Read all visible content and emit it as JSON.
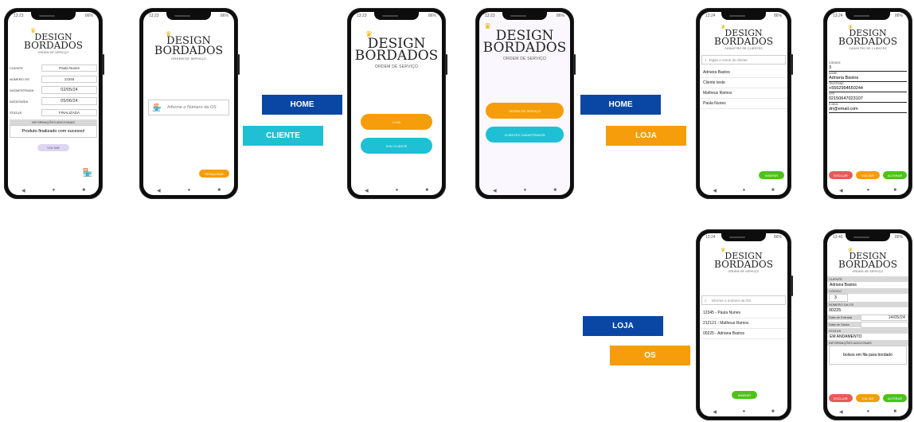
{
  "labels": {
    "home1": "HOME",
    "cliente": "CLIENTE",
    "home2": "HOME",
    "loja1": "LOJA",
    "loja2": "LOJA",
    "os": "OS"
  },
  "colors": {
    "navy": "#0a47a5",
    "cyan": "#1fc0d3",
    "orange": "#f59d0a",
    "green": "#4cc417",
    "red": "#e85a5a",
    "lavender": "#dcd6f2"
  },
  "logo": {
    "line1": "DESIGN",
    "line2": "BORDADOS",
    "sub_os": "ORDEM DE SERVIÇO",
    "sub_cad": "CADASTRO DE CLIENTES"
  },
  "status": {
    "time": "13:23",
    "time2": "13:24",
    "time3": "13:40",
    "battery": "86%"
  },
  "phone1": {
    "rows": [
      {
        "label": "CLIENTE",
        "value": "Paula Nunes"
      },
      {
        "label": "NÚMERO OS",
        "value": "12345"
      },
      {
        "label": "DATA/ENTRADA",
        "value": "02/05/24"
      },
      {
        "label": "DATA/SAÍDA",
        "value": "05/06/24"
      },
      {
        "label": "STATUS",
        "value": "FINALIZADA"
      }
    ],
    "info_header": "INFORMAÇÕES ADICIONAIS",
    "info_text": "Produto finalizado com sucesso!",
    "back": "VOLTAR"
  },
  "phone2": {
    "placeholder": "Informe o Número da OS",
    "search": "PESQUISAR"
  },
  "phone3": {
    "loja": "LOJA",
    "sou_cliente": "SOU CLIENTE"
  },
  "phone4": {
    "ordem": "ORDEM DE SERVIÇO",
    "cadastro": "CLIENTES CADASTRADOS"
  },
  "phone5": {
    "search_placeholder": "Digite o nome do cliente",
    "clients": [
      "Adriana Bastos",
      "Cliente teste",
      "Matheus Ramos",
      "Paula Nunes"
    ],
    "insert": "INSERIR"
  },
  "phone6": {
    "fields": [
      {
        "label": "CÓDIGO:",
        "value": "3"
      },
      {
        "label": "NOME:",
        "value": "Adriana Bastos"
      },
      {
        "label": "TELEFONE:",
        "value": "+5562994650244"
      },
      {
        "label": "CPF:",
        "value": "02150647023107"
      },
      {
        "label": "E-MAIL:",
        "value": "dri@email.com"
      }
    ],
    "delete": "EXCLUIR",
    "back": "VOLTAR",
    "update": "ALTERAR"
  },
  "phone7": {
    "search_placeholder": "Informe o número da OS",
    "orders": [
      "12345 - Paula Nunes",
      "212121 - Matheus Ramos",
      "00225 - Adriana Bastos"
    ],
    "insert": "INSERIR"
  },
  "phone8": {
    "client_label": "CLIENTE",
    "client_value": "Adriana Bastos",
    "code_label": "CÓDIGO",
    "code_value": "3",
    "os_label": "NÚMERO DA OS",
    "os_value": "00225",
    "entry_label": "Data de Entrada",
    "entry_value": "14/05/24",
    "exit_label": "Data de Saída",
    "status_label": "STATUS",
    "status_value": "EM ANDAMENTO",
    "info_label": "INFORMAÇÕES ADICIONAIS",
    "info_value": "bolsos em fila para bordado",
    "delete": "EXCLUIR",
    "back": "VOLTAR",
    "update": "ALTERAR"
  }
}
